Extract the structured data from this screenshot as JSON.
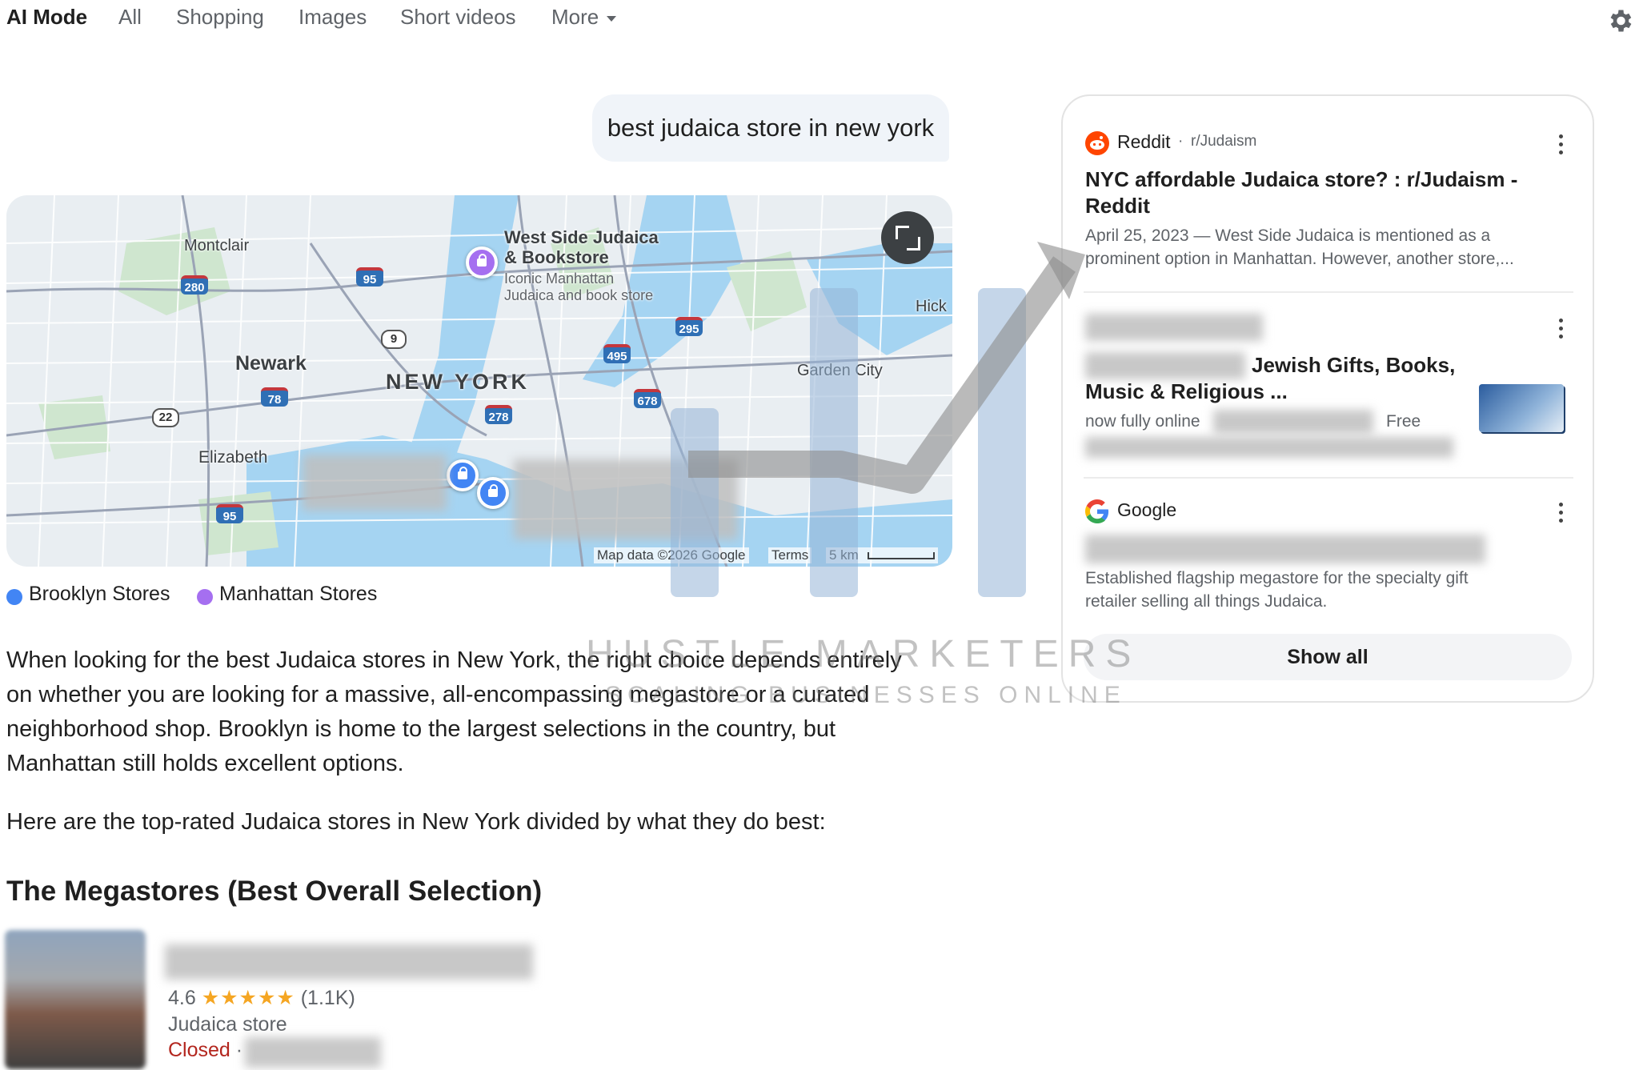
{
  "nav": {
    "active": "AI Mode",
    "items": [
      "All",
      "Shopping",
      "Images",
      "Short videos"
    ],
    "more": "More"
  },
  "query": "best judaica store in new york",
  "map": {
    "places": {
      "montclair": "Montclair",
      "newark": "Newark",
      "new_york": "NEW YORK",
      "elizabeth": "Elizabeth",
      "garden_city": "Garden City",
      "hick": "Hick"
    },
    "highways": [
      "280",
      "95",
      "9",
      "495",
      "295",
      "678",
      "278",
      "78",
      "22",
      "95"
    ],
    "pin_label": {
      "name_line1": "West Side Judaica",
      "name_line2": "& Bookstore",
      "desc_line1": "Iconic Manhattan",
      "desc_line2": "Judaica and book store"
    },
    "attribution": "Map data ©2026 Google",
    "terms": "Terms",
    "scale": "5 km"
  },
  "legend": [
    {
      "label": "Brooklyn Stores",
      "color": "#4285f4"
    },
    {
      "label": "Manhattan Stores",
      "color": "#a56ff0"
    }
  ],
  "body": {
    "p1_line1": "When looking for the best Judaica stores in New York, the right choice depends entirely",
    "p1_line2": "on whether you are looking for a massive, all-encompassing megastore or a curated",
    "p1_line3": "neighborhood shop. Brooklyn is home to the largest selections in the country, but",
    "p1_line4": "Manhattan still holds excellent options.",
    "p2": "Here are the top-rated Judaica stores in New York divided by what they do best:",
    "heading": "The Megastores (Best Overall Selection)"
  },
  "listing": {
    "rating": "4.6",
    "stars": "★★★★★",
    "reviews": "(1.1K)",
    "category": "Judaica store",
    "status": "Closed",
    "separator": "·"
  },
  "sources": {
    "reddit": {
      "name": "Reddit",
      "dot": "·",
      "sub": "r/Judaism",
      "title_line1": "NYC affordable Judaica store? : r/Judaism -",
      "title_line2": "Reddit",
      "snippet_line1": "April 25, 2023 — West Side Judaica is mentioned as a",
      "snippet_line2": "prominent option in Manhattan. However, another store,..."
    },
    "second": {
      "title_line1": "Jewish Gifts, Books,",
      "title_line2": "Music & Religious ...",
      "snippet_left": "now fully online",
      "snippet_right": "Free"
    },
    "google": {
      "name": "Google",
      "snippet_line1": "Established flagship megastore for the specialty gift",
      "snippet_line2": "retailer selling all things Judaica."
    },
    "show_all": "Show all"
  },
  "watermark": {
    "brand": "HUSTLE MARKETERS",
    "tagline": "SCALING BUSINESSES ONLINE"
  },
  "colors": {
    "brooklyn": "#4285f4",
    "manhattan": "#a56ff0",
    "reddit": "#ff4500",
    "closed": "#b3261e"
  },
  "icons": [
    "settings-icon",
    "expand-icon",
    "reddit-logo-icon",
    "google-logo-icon",
    "more-vert-icon",
    "shopping-bag-pin-icon"
  ]
}
